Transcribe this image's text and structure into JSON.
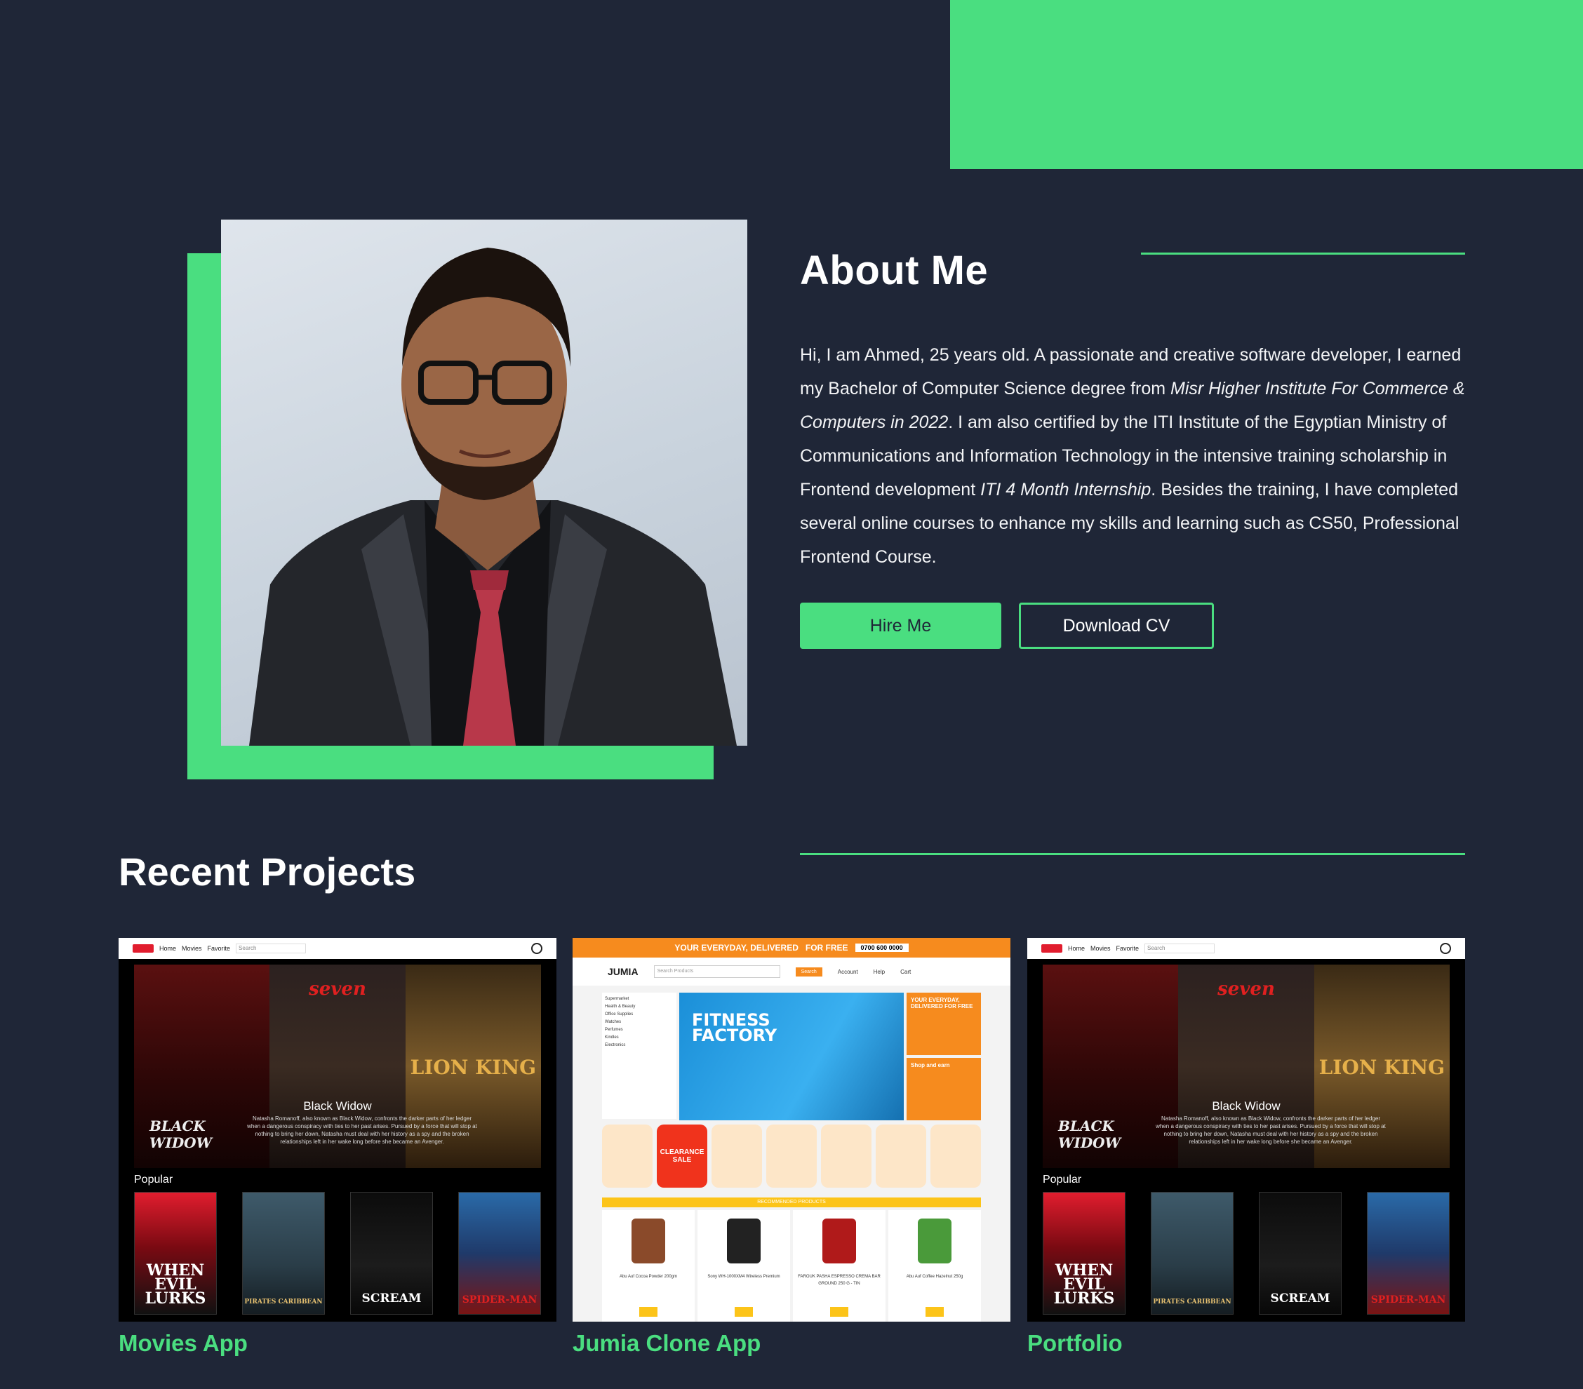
{
  "about": {
    "title": "About Me",
    "paragraph": [
      {
        "text": "Hi, I am Ahmed, 25 years old. A passionate and creative software developer, I earned my Bachelor of Computer Science degree from ",
        "italic": false
      },
      {
        "text": "Misr Higher Institute For Commerce & Computers in 2022",
        "italic": true
      },
      {
        "text": ". I am also certified by the ITI Institute of the Egyptian Ministry of Communications and Information Technology in the intensive training scholarship in Frontend development ",
        "italic": false
      },
      {
        "text": "ITI 4 Month Internship",
        "italic": true
      },
      {
        "text": ". Besides the training, I have completed several online courses to enhance my skills and learning such as CS50, Professional Frontend Course.",
        "italic": false
      }
    ],
    "hire_label": "Hire Me",
    "cv_label": "Download CV"
  },
  "projects": {
    "title": "Recent Projects",
    "items": [
      {
        "label": "Movies App"
      },
      {
        "label": "Jumia Clone App"
      },
      {
        "label": "Portfolio"
      }
    ]
  },
  "movies_mock": {
    "nav": [
      "Home",
      "Movies",
      "Favorite"
    ],
    "search_placeholder": "Search",
    "hero_titles": [
      "BLACK WIDOW",
      "seven",
      "LION KING"
    ],
    "hero_heading": "Black Widow",
    "hero_desc": "Natasha Romanoff, also known as Black Widow, confronts the darker parts of her ledger when a dangerous conspiracy with ties to her past arises. Pursued by a force that will stop at nothing to bring her down, Natasha must deal with her history as a spy and the broken relationships left in her wake long before she became an Avenger.",
    "popular_label": "Popular",
    "thumbs": [
      "WHEN EVIL LURKS",
      "PIRATES CARIBBEAN",
      "SCREAM",
      "SPIDER-MAN"
    ]
  },
  "jumia_mock": {
    "promo": "YOUR EVERYDAY, DELIVERED",
    "promo_free": "FOR FREE",
    "phone": "0700 600 0000",
    "logo": "JUMIA",
    "search_placeholder": "Search Products",
    "search_btn": "Search",
    "header_links": [
      "Account",
      "Help",
      "Cart"
    ],
    "categories": [
      "Supermarket",
      "Health & Beauty",
      "Office Supplies",
      "Watches",
      "Perfumes",
      "Kindles",
      "Electronics"
    ],
    "banner_title_1": "FITNESS",
    "banner_title_2": "FACTORY",
    "ad1": "YOUR EVERYDAY, DELIVERED FOR FREE",
    "ad2": "Shop and earn",
    "clearance": "CLEARANCE SALE",
    "recommended": "RECOMMENDED PRODUCTS",
    "products": [
      "Abu Auf Cocoa Powder 200gm",
      "Sony WH-1000XM4 Wireless Premium",
      "FAROUK PASHA ESPRESSO CREMA BAR GROUND 250 G - TIN",
      "Abu Auf Coffee Hazelnut 250g"
    ]
  }
}
